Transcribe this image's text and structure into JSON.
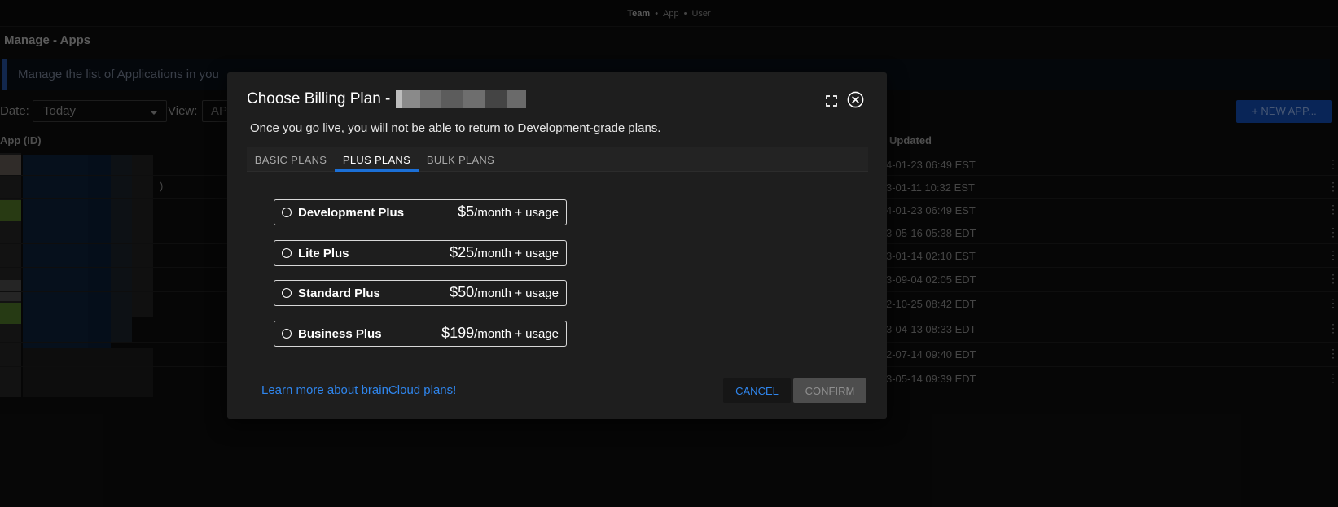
{
  "topbar": {
    "team": "Team",
    "sep": "•",
    "app": "App",
    "user": "User"
  },
  "page": {
    "title": "Manage - Apps",
    "info": "Manage the list of Applications in you"
  },
  "filters": {
    "date_label": "Date:",
    "date_value": "Today",
    "view_label": "View:",
    "view_value": "AP"
  },
  "new_app_label": "+ NEW APP...",
  "table": {
    "col_app": "App (ID)",
    "col_updated": "Updated",
    "row_fragment": ")",
    "rows": [
      {
        "updated": "4-01-23 06:49 EST"
      },
      {
        "updated": "3-01-11 10:32 EST"
      },
      {
        "updated": "4-01-23 06:49 EST"
      },
      {
        "updated": "3-05-16 05:38 EDT"
      },
      {
        "updated": "3-01-14 02:10 EST"
      },
      {
        "updated": "3-09-04 02:05 EDT"
      },
      {
        "updated": "2-10-25 08:42 EDT"
      },
      {
        "updated": "3-04-13 08:33 EDT"
      },
      {
        "updated": "2-07-14 09:40 EDT"
      },
      {
        "updated": "3-05-14 09:39 EDT"
      }
    ],
    "kebab": "⋮"
  },
  "modal": {
    "title": "Choose Billing Plan - ",
    "subtitle": "Once you go live, you will not be able to return to Development-grade plans.",
    "tabs": [
      {
        "label": "BASIC PLANS"
      },
      {
        "label": "PLUS PLANS",
        "active": true
      },
      {
        "label": "BULK PLANS"
      }
    ],
    "plans": [
      {
        "name": "Development Plus",
        "price": "$5",
        "suffix": "/month + usage"
      },
      {
        "name": "Lite Plus",
        "price": "$25",
        "suffix": "/month + usage"
      },
      {
        "name": "Standard Plus",
        "price": "$50",
        "suffix": "/month + usage"
      },
      {
        "name": "Business Plus",
        "price": "$199",
        "suffix": "/month + usage"
      }
    ],
    "learn_more": "Learn more about brainCloud plans!",
    "cancel": "CANCEL",
    "confirm": "CONFIRM"
  },
  "colors": {
    "accent": "#2f86ee",
    "tab_indicator": "#1b6fd6",
    "modal_bg": "#1e1e1e"
  }
}
